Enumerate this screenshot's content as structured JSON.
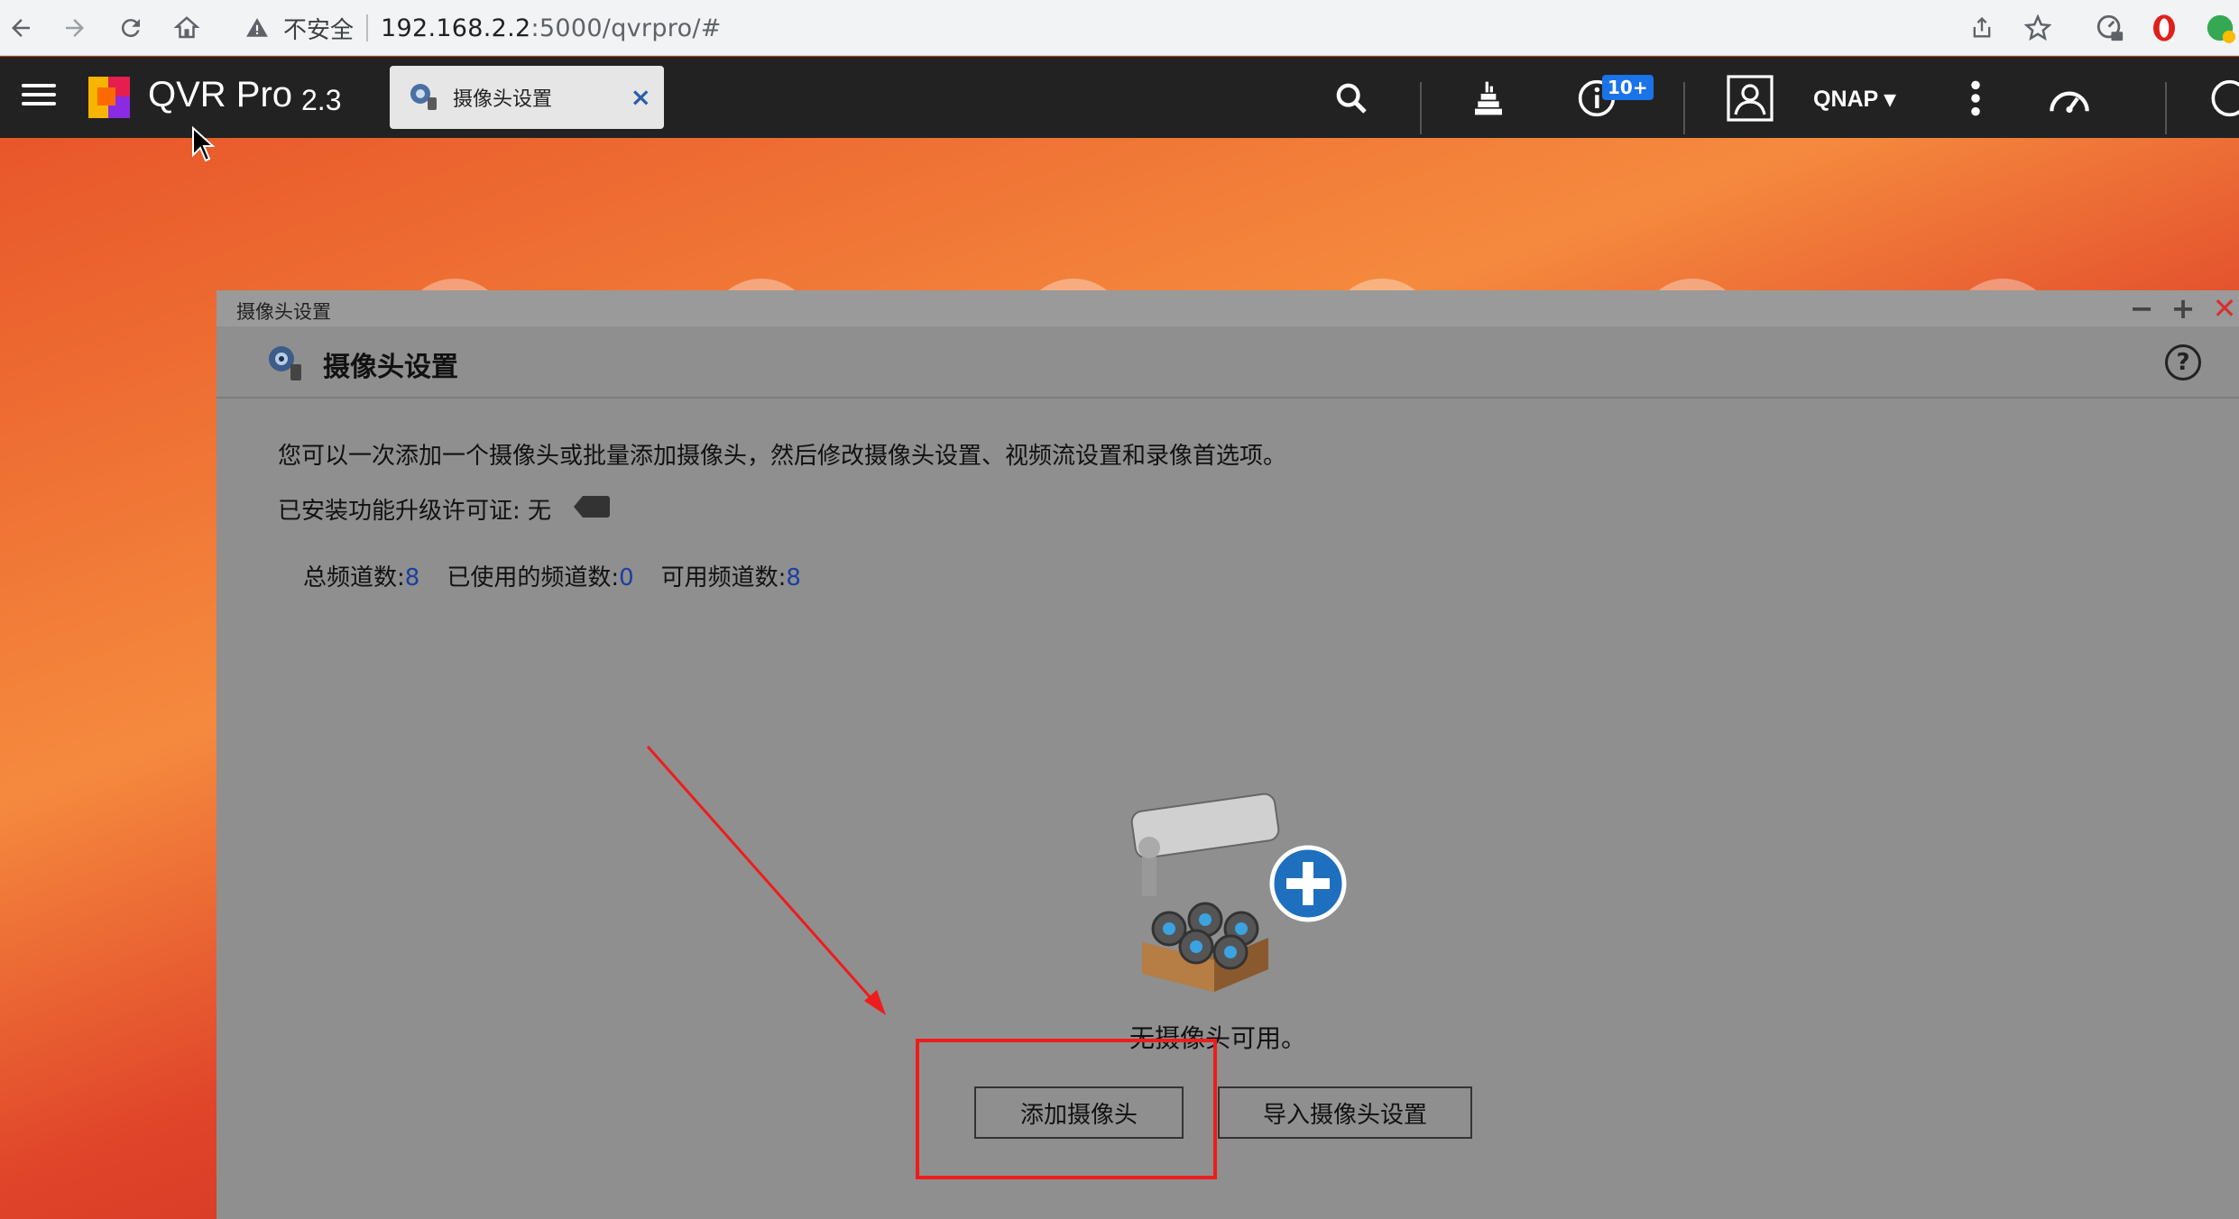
{
  "browser": {
    "security_label": "不安全",
    "url_host": "192.168.2.2",
    "url_path": ":5000/qvrpro/#",
    "icons": [
      "back-icon",
      "forward-icon",
      "reload-icon",
      "home-icon",
      "warning-icon",
      "share-icon",
      "star-icon",
      "extension-icon",
      "opera-icon",
      "profile-icon"
    ]
  },
  "app": {
    "name": "QVR Pro",
    "version": "2.3",
    "tab_label": "摄像头设置",
    "tab_close": "×",
    "notification_count": "10+",
    "user": "QNAP ▾",
    "icons": [
      "menu-icon",
      "search-icon",
      "tasks-icon",
      "info-icon",
      "user-icon",
      "more-icon",
      "dashboard-icon"
    ]
  },
  "window": {
    "title": "摄像头设置",
    "header_title": "摄像头设置",
    "help": "?",
    "controls": {
      "minimize": "−",
      "maximize": "+",
      "close": "✕"
    },
    "description": "您可以一次添加一个摄像头或批量添加摄像头，然后修改摄像头设置、视频流设置和录像首选项。",
    "license_label": "已安装功能升级许可证: 无",
    "channels": {
      "total_label": "总频道数:",
      "total_value": "8",
      "used_label": "已使用的频道数:",
      "used_value": "0",
      "available_label": "可用频道数:",
      "available_value": "8"
    },
    "empty_message": "无摄像头可用。",
    "add_button": "添加摄像头",
    "import_button": "导入摄像头设置"
  },
  "colors": {
    "header_bg": "#222222",
    "window_bg": "#8f8f8f",
    "accent_blue": "#1a73e8",
    "annotation_red": "#ee1c1c"
  }
}
